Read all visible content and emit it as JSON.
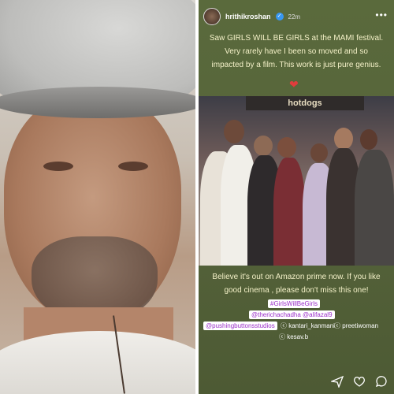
{
  "story": {
    "username": "hrithikroshan",
    "time": "22m",
    "caption_top": "Saw GIRLS WILL BE GIRLS at the MAMI festival. Very rarely have I been so moved and so impacted by a film. This work is just pure genius.",
    "heart": "❤",
    "sign_text": "hotdogs",
    "caption_bottom": "Believe it's out on Amazon prime now. If you like good cinema , please don't miss this one!",
    "hashtag": "#GirlsWillBeGirls",
    "mentions_line1": "@therichachadha @alifazal9",
    "mentions_line2_a": "@pushingbuttonsstudios",
    "mentions_line2_b": "kantari_kanmani",
    "mentions_line2_c": "preetiwoman",
    "mentions_line3": "kesav.b"
  },
  "icons": [
    "verified-icon",
    "more-icon",
    "send-icon",
    "like-icon",
    "comment-icon"
  ]
}
